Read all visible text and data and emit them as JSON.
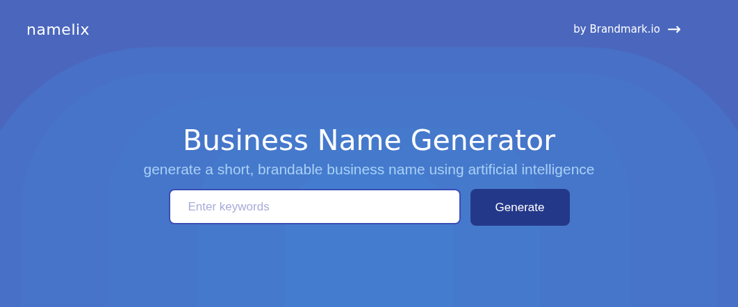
{
  "header": {
    "logo": "namelix",
    "link": {
      "label": "by Brandmark.io",
      "icon": "→"
    }
  },
  "hero": {
    "title": "Business Name Generator",
    "subtitle": "generate a short, brandable business name using artificial intelligence"
  },
  "search": {
    "placeholder": "Enter keywords",
    "button": "Generate"
  }
}
